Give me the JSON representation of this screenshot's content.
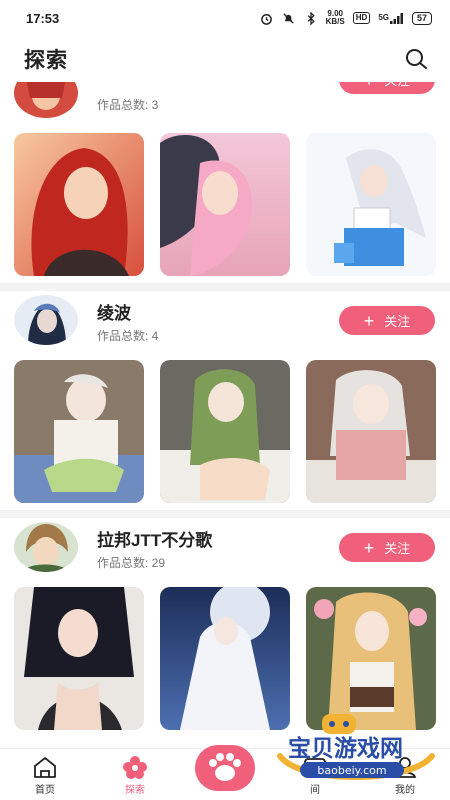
{
  "status_bar": {
    "time": "17:53",
    "net_speed_value": "9.00",
    "net_speed_unit": "KB/S",
    "hd": "HD",
    "signal": "5G",
    "battery": "57"
  },
  "header": {
    "title": "探索"
  },
  "creators": [
    {
      "name": "",
      "count_label": "作品总数: 3",
      "follow_label": "关注"
    },
    {
      "name": "绫波",
      "count_label": "作品总数: 4",
      "follow_label": "关注"
    },
    {
      "name": "拉邦JTT不分歌",
      "count_label": "作品总数: 29",
      "follow_label": "关注"
    }
  ],
  "bottom_nav": {
    "home": "首页",
    "explore": "探索",
    "message": "间",
    "mine": "我的"
  },
  "watermark": {
    "brand": "宝贝游戏网",
    "url": "baobeiy.com"
  },
  "colors": {
    "accent": "#f0607a",
    "divider": "#f3f3f3"
  }
}
